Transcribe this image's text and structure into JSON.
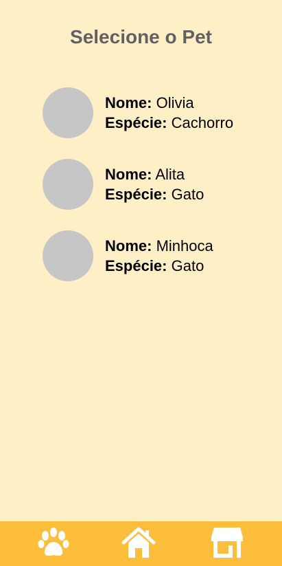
{
  "header": {
    "title": "Selecione o Pet"
  },
  "labels": {
    "name": "Nome:",
    "species": "Espécie:"
  },
  "pets": [
    {
      "name": "Olivia",
      "species": "Cachorro"
    },
    {
      "name": "Alita",
      "species": "Gato"
    },
    {
      "name": "Minhoca",
      "species": "Gato"
    }
  ],
  "bottom_nav": {
    "items": [
      {
        "icon": "paw-icon"
      },
      {
        "icon": "home-icon"
      },
      {
        "icon": "store-icon"
      }
    ]
  },
  "colors": {
    "background": "#FFEFC7",
    "nav_bar": "#FDBE3B",
    "avatar_placeholder": "#C6C6C6",
    "title_text": "#616161",
    "icon": "#FFFFFF"
  }
}
